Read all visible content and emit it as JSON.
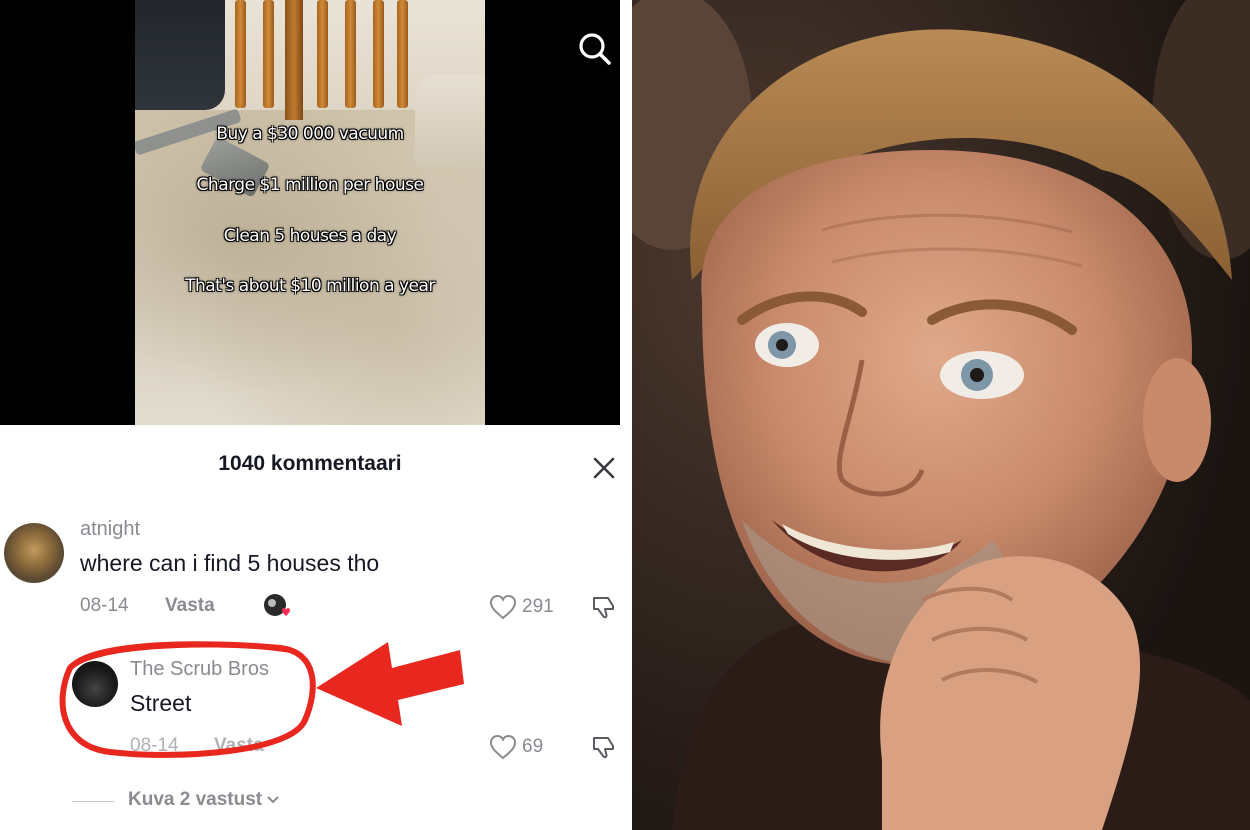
{
  "video": {
    "captions": [
      "Buy a $30 000 vacuum",
      "Charge $1 million per house",
      "Clean 5 houses a day",
      "That's about $10 million a year"
    ]
  },
  "comments_sheet": {
    "title": "1040 kommentaari",
    "comments": [
      {
        "username": "atnight",
        "text": "where can i find 5 houses tho",
        "date": "08-14",
        "reply_label": "Vasta",
        "likes": "291"
      },
      {
        "username": "The Scrub Bros",
        "text": "Street",
        "date": "08-14",
        "reply_label": "Vasta",
        "likes": "69"
      }
    ],
    "view_replies_label": "Kuva 2 vastust"
  },
  "colors": {
    "annotation_red": "#e8271e",
    "text_primary": "#161823",
    "text_secondary": "#8a8b91"
  },
  "icons": [
    "search-icon",
    "close-icon",
    "heart-icon",
    "dislike-icon",
    "chevron-down-icon",
    "arrow-annotation"
  ]
}
